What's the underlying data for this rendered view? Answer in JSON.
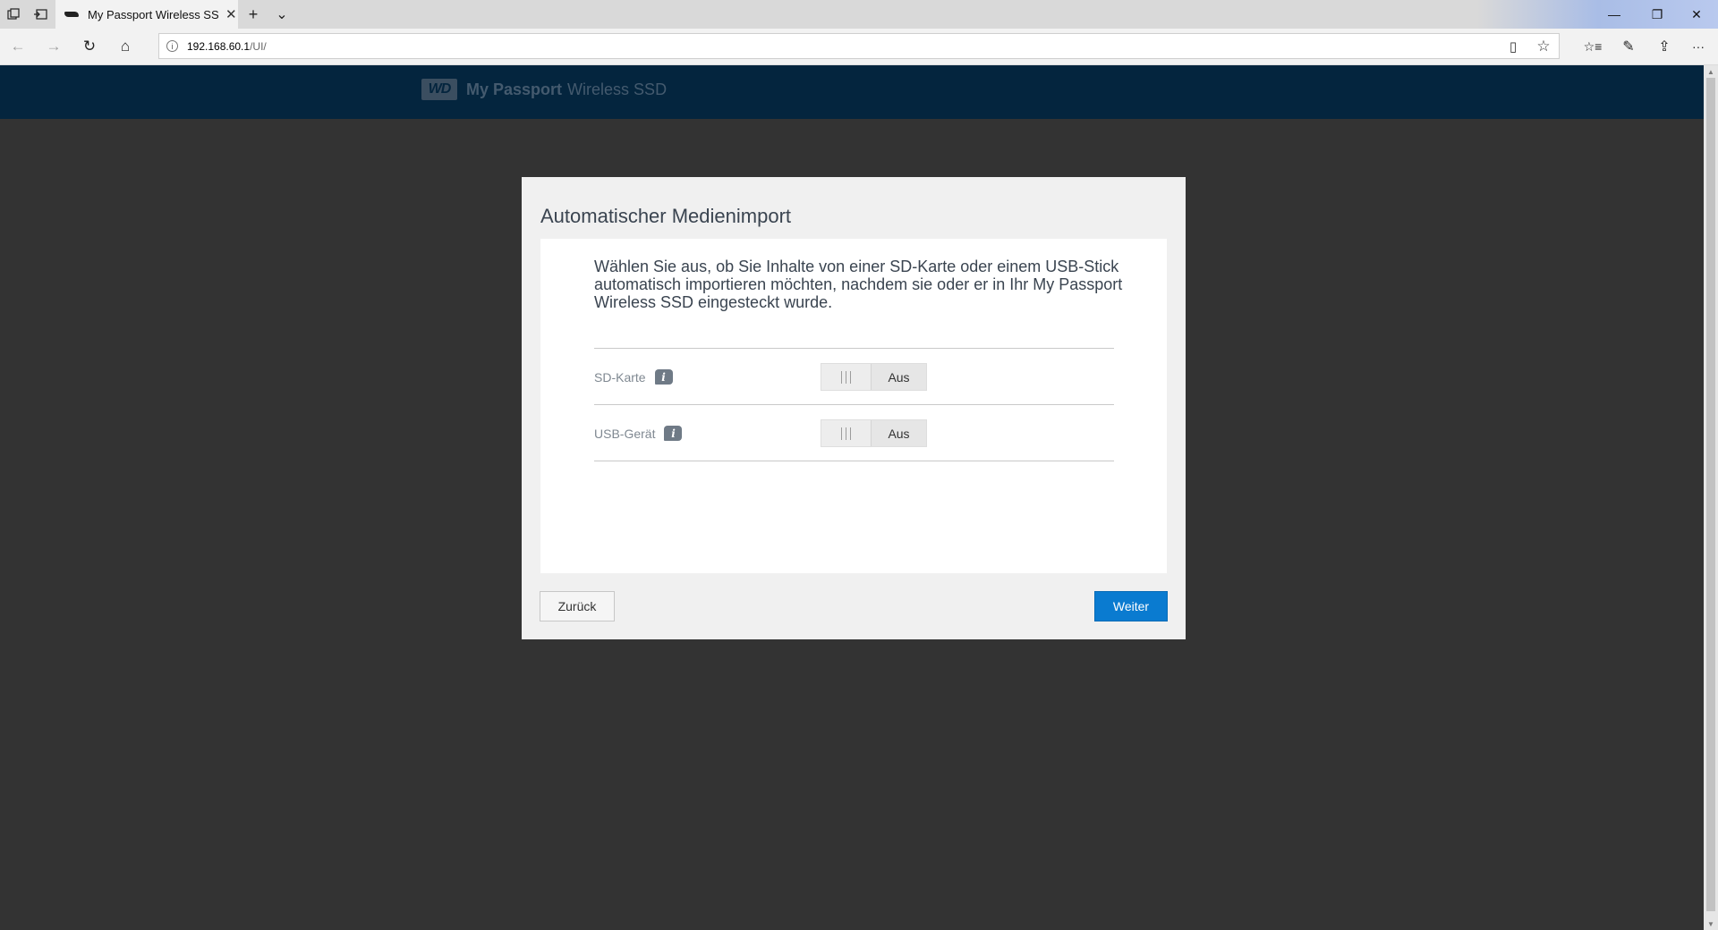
{
  "browser": {
    "tab_title": "My Passport Wireless SSD",
    "address": {
      "host": "192.168.60.1",
      "path": "/UI/"
    },
    "icons": {
      "tab_actions": "tab-actions-icon",
      "set_aside": "set-aside-tabs-icon",
      "new_tab": "+",
      "tab_list": "⌄",
      "back": "←",
      "forward": "→",
      "refresh": "↻",
      "home": "⌂",
      "reading_view": "▯",
      "favorite": "☆",
      "favorites_hub": "☆≡",
      "notes": "✎",
      "share": "⇪",
      "more": "···",
      "minimize": "—",
      "restore": "❐",
      "close": "✕"
    }
  },
  "app": {
    "logo_text": "WD",
    "brand_bold": "My Passport",
    "brand_light": "Wireless SSD"
  },
  "dialog": {
    "title": "Automatischer Medienimport",
    "description": "Wählen Sie aus, ob Sie Inhalte von einer SD-Karte oder einem USB-Stick automatisch importieren möchten, nachdem sie oder er in Ihr My Passport Wireless SSD eingesteckt wurde.",
    "settings": [
      {
        "label": "SD-Karte",
        "info": "i",
        "state": "Aus"
      },
      {
        "label": "USB-Gerät",
        "info": "i",
        "state": "Aus"
      }
    ],
    "back_label": "Zurück",
    "next_label": "Weiter"
  }
}
